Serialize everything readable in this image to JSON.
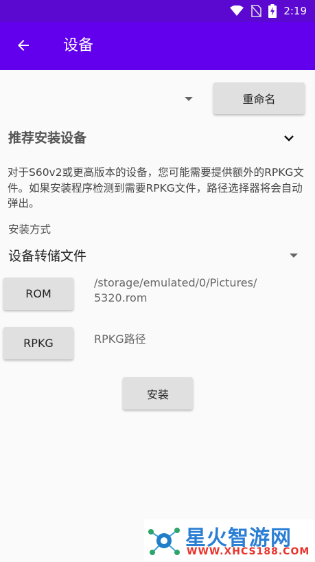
{
  "status_bar": {
    "time": "2:19"
  },
  "app_bar": {
    "title": "设备"
  },
  "device_selector": {
    "rename_label": "重命名"
  },
  "recommended": {
    "title": "推荐安装设备",
    "description": "对于S60v2或更高版本的设备，您可能需要提供额外的RPKG文件。如果安装程序检测到需要RPKG文件，路径选择器将会自动弹出。"
  },
  "install_method": {
    "label": "安装方式",
    "value": "设备转储文件"
  },
  "rom": {
    "button_label": "ROM",
    "path": "/storage/emulated/0/Pictures/\n5320.rom"
  },
  "rpkg": {
    "button_label": "RPKG",
    "path": "RPKG路径"
  },
  "install_button": {
    "label": "安装"
  },
  "watermark": {
    "text": "星火智游网",
    "url": "WWW.XHCS188.COM"
  }
}
